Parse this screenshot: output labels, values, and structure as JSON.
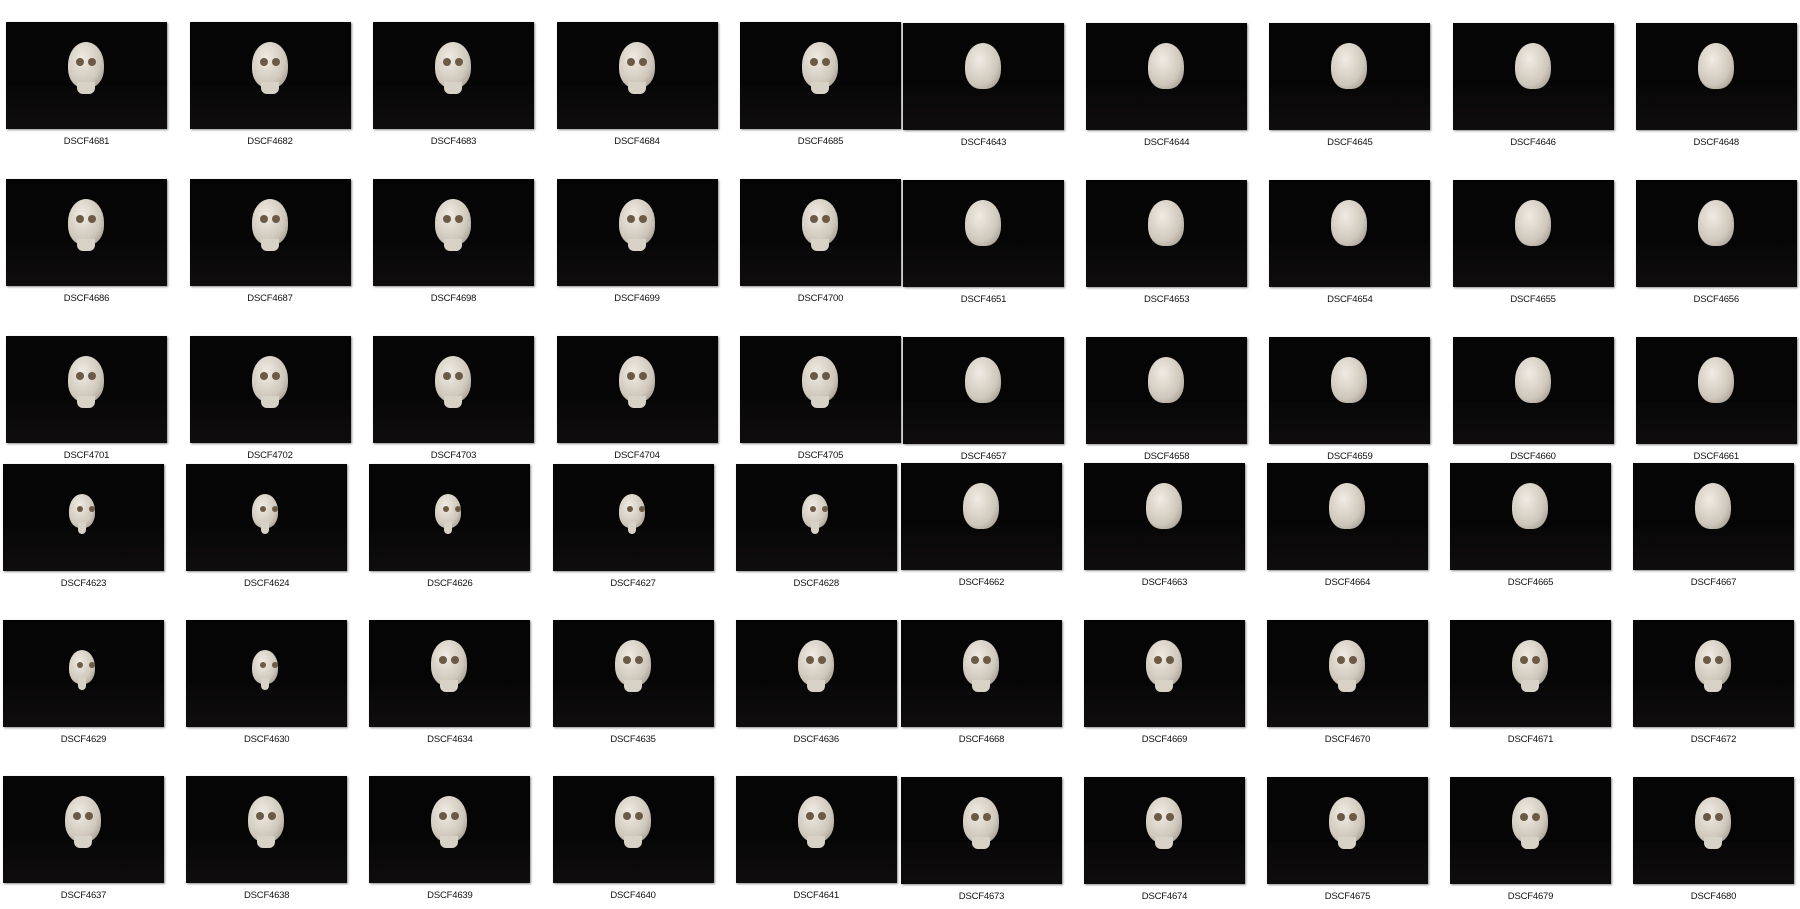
{
  "groups": [
    {
      "items": [
        "DSCF4681",
        "DSCF4682",
        "DSCF4683",
        "DSCF4684",
        "DSCF4685",
        "DSCF4686",
        "DSCF4687",
        "DSCF4698",
        "DSCF4699",
        "DSCF4700",
        "DSCF4701",
        "DSCF4702",
        "DSCF4703",
        "DSCF4704",
        "DSCF4705"
      ],
      "view": "front"
    },
    {
      "items": [
        "DSCF4643",
        "DSCF4644",
        "DSCF4645",
        "DSCF4646",
        "DSCF4648",
        "DSCF4651",
        "DSCF4653",
        "DSCF4654",
        "DSCF4655",
        "DSCF4656",
        "DSCF4657",
        "DSCF4658",
        "DSCF4659",
        "DSCF4660",
        "DSCF4661"
      ],
      "view": "back"
    },
    {
      "items": [
        "DSCF4623",
        "DSCF4624",
        "DSCF4626",
        "DSCF4627",
        "DSCF4628",
        "DSCF4629",
        "DSCF4630",
        "DSCF4634",
        "DSCF4635",
        "DSCF4636",
        "DSCF4637",
        "DSCF4638",
        "DSCF4639",
        "DSCF4640",
        "DSCF4641"
      ],
      "view": "front"
    },
    {
      "items": [
        "DSCF4662",
        "DSCF4663",
        "DSCF4664",
        "DSCF4665",
        "DSCF4667",
        "DSCF4668",
        "DSCF4669",
        "DSCF4670",
        "DSCF4671",
        "DSCF4672",
        "DSCF4673",
        "DSCF4674",
        "DSCF4675",
        "DSCF4679",
        "DSCF4680"
      ],
      "view": "back"
    }
  ]
}
